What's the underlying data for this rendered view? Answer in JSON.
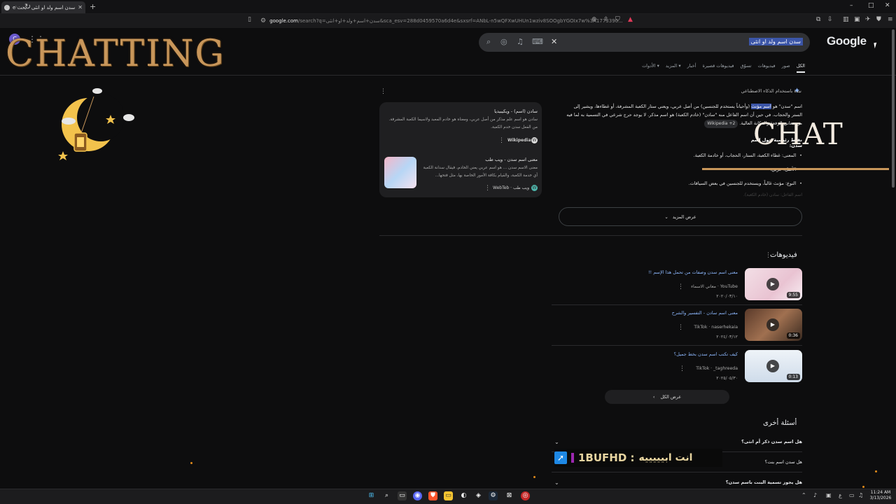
{
  "browser": {
    "tab_title": "سدن اسم ولد او انثى - بحث Google",
    "new_tab": "+",
    "url_host": "google.com",
    "url_rest": "/search?q=سدن+اسم+ولد+او+انثى&sca_esv=288d0459570a6d4e&sxsrf=ANbL-n5wQFXwUHUn1wziv8SOOgbYGOIx7w%3A1773390...",
    "window_controls": [
      "–",
      "□",
      "✕"
    ]
  },
  "google": {
    "logo": "Google",
    "query": "سدن اسم ولد او انثى",
    "avatar_letter": "C",
    "tabs": [
      {
        "label": "الكل",
        "active": true
      },
      {
        "label": "صور"
      },
      {
        "label": "فيديوهات"
      },
      {
        "label": "تسوّق"
      },
      {
        "label": "فيديوهات قصيرة"
      },
      {
        "label": "أخبار"
      },
      {
        "label": "المزيد ▾"
      },
      {
        "label": "الأدوات ▾"
      }
    ]
  },
  "ai_overview": {
    "heading": "نبذة باستخدام الذكاء الاصطناعي",
    "para_before": "اسم \"سدن\" هو ",
    "para_highlight": "اسم مؤنث",
    "para_after": " (وأحياناً يستخدم للجنسين) من أصل عربي، ويعني ستار الكعبة المشرفة، أو غطاءها، ويشير إلى الستر والحجاب. في حين أن اسم الفاعل منه \"سادن\" (خادم الكعبة) هو اسم مذكر. لا يوجد حرج شرعي في التسمية به لما فيه من معاني الرفعة والمكانة العالية.",
    "wiki_chip": "Wikipedia +2",
    "subheading": "نقاط رئيسية حول اسم سدن:",
    "bullets": [
      "المعنى: غطاء الكعبة، الستار، الحجاب، أو خادمة الكعبة.",
      "الأصل: عربي.",
      "النوع: مؤنث غالباً، ويستخدم للجنسين في بعض السياقات."
    ],
    "faded_line": "اسم الفاعل: سادن (خادم الكعبة).",
    "show_more": "عرض المزيد"
  },
  "sources": [
    {
      "title": "سادن (اسم) - ويكيبيديا",
      "body": "سادن هو اسم علم مذكر من أصل عربي، ومعناه هو خادم المعبد ولاسيما الكعبة المشرفة. من الفعل سدن خدم الكعبة.",
      "site": "Wikipedia",
      "fav": "W"
    },
    {
      "title": "معنى اسم سدن - ويب طب",
      "body": "معنى الاسم سدن ... هو اسم عربي يعني الخادم، فيقال سدانة الكعبة أي خدمة الكعبة، والقيام بكافة الأمور الخاصة بها، مثل فتحها...",
      "site": "ويب طب · WebTeb",
      "fav": "W"
    }
  ],
  "videos": {
    "heading": "فيديوهات",
    "items": [
      {
        "title": "معنى اسم سدن وصفات من تحمل هذا الإسم !!",
        "source": "YouTube · معاني الاسماء",
        "date": "٢٠٢٠/٠٣/١٠",
        "duration": "9:55",
        "thumb_color": "#f3dfe6"
      },
      {
        "title": "معنى اسم سادن - التفسير والشرح",
        "source": "TikTok · naserhekaia",
        "date": "٢٠٢٤/٠٣/١٢",
        "duration": "0:36",
        "thumb_color": "#8a5a3a"
      },
      {
        "title": "كيف تكتب اسم سدن بخط جميل؟",
        "source": "TikTok · _taghreeda",
        "date": "٢٠٢٥/٠٥/٣٠",
        "duration": "0:13",
        "thumb_color": "#d8e3ef"
      }
    ],
    "view_all": "عرض الكل"
  },
  "paa": {
    "heading": "أسئلة أخرى",
    "questions": [
      "هل اسم سدن ذكر أم انثى؟",
      "هل سدن اسم بنت؟",
      "هل يجوز تسمية البنت باسم سدن؟"
    ]
  },
  "overlay": {
    "chatting": "CHATTING",
    "chat": "CHAT",
    "chat_user": "1BUFHD :",
    "chat_message": "انت ابيييييه"
  },
  "taskbar": {
    "time": "11:24 AM",
    "date": "3/13/2026"
  },
  "colors": {
    "accent_gold": "#c8965a",
    "link_blue": "#8ab4f8",
    "highlight": "#3b55a8"
  }
}
